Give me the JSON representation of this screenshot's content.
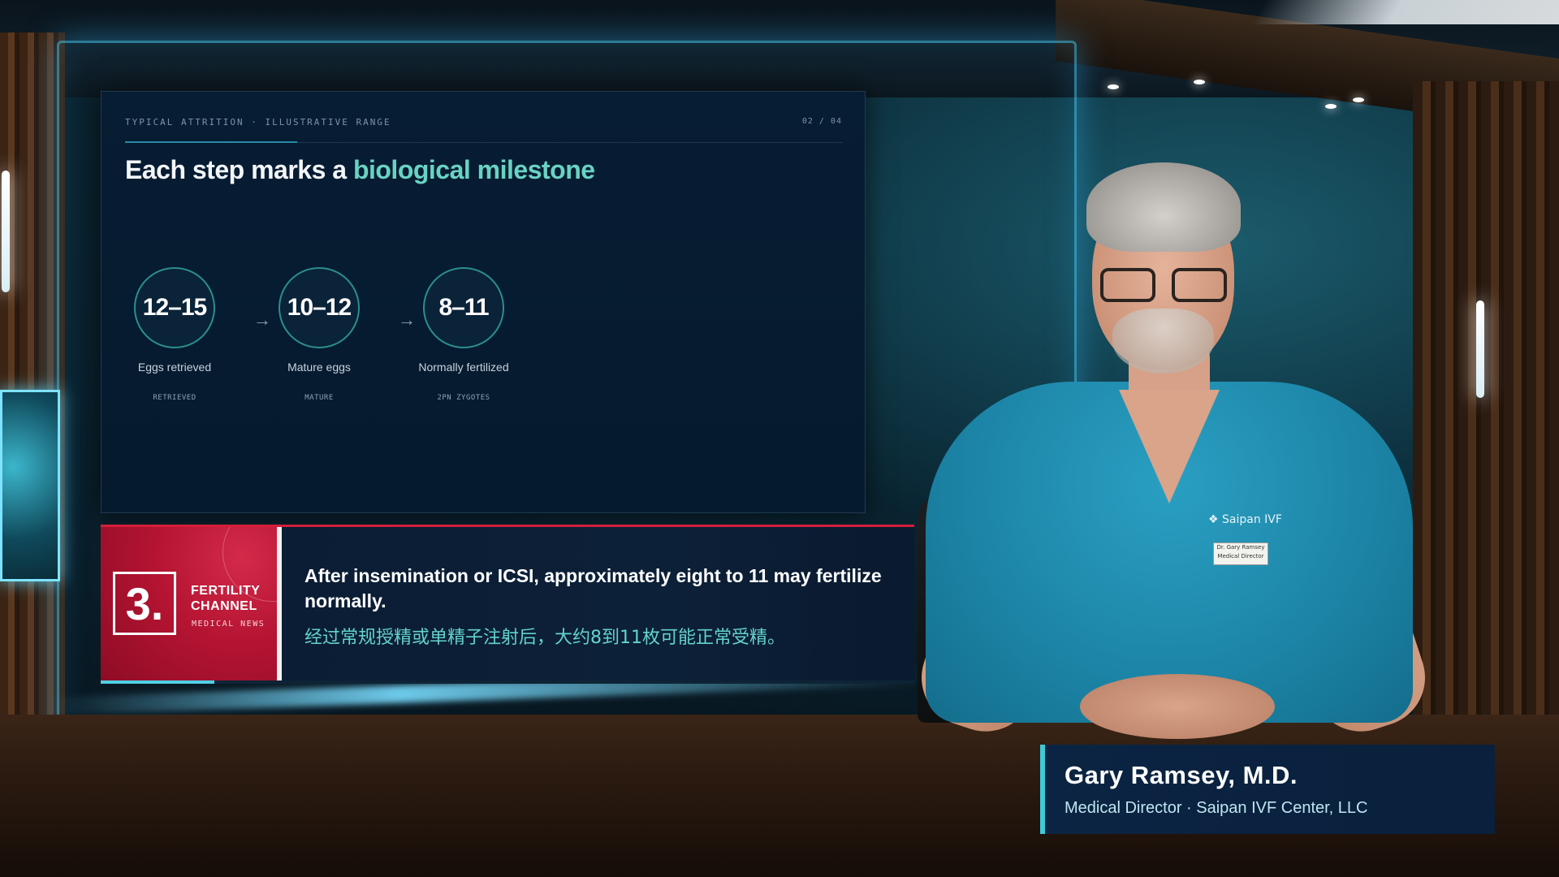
{
  "slide": {
    "kicker": "TYPICAL ATTRITION · ILLUSTRATIVE RANGE",
    "page": "02 / 04",
    "progress_fraction": 0.24,
    "title_prefix": "Each step marks a",
    "title_accent": "biological milestone",
    "steps": [
      {
        "value": "12–15",
        "label": "Eggs retrieved",
        "tag": "RETRIEVED"
      },
      {
        "value": "10–12",
        "label": "Mature eggs",
        "tag": "MATURE"
      },
      {
        "value": "8–11",
        "label": "Normally fertilized",
        "tag": "2PN ZYGOTES"
      }
    ],
    "arrow_glyph": "→"
  },
  "lower_third": {
    "logo_mark": "3.",
    "channel_line1": "FERTILITY",
    "channel_line2": "CHANNEL",
    "channel_sub": "MEDICAL NEWS",
    "caption_en": "After insemination or ICSI, approximately eight to 11 may fertilize normally.",
    "caption_zh": "经过常规授精或单精子注射后，大约8到11枚可能正常受精。",
    "progress_fraction": 0.14,
    "accent_color": "#d41f3c"
  },
  "nameplate": {
    "name": "Gary Ramsey, M.D.",
    "role": "Medical Director · Saipan IVF Center, LLC"
  },
  "scrubs": {
    "chest_logo": "Saipan IVF",
    "badge_line1": "Dr. Gary Ramsey",
    "badge_line2": "Medical Director"
  },
  "colors": {
    "accent_teal": "#69d3c3",
    "brand_red": "#b51432",
    "nameplate_stripe": "#3ec9d6"
  }
}
